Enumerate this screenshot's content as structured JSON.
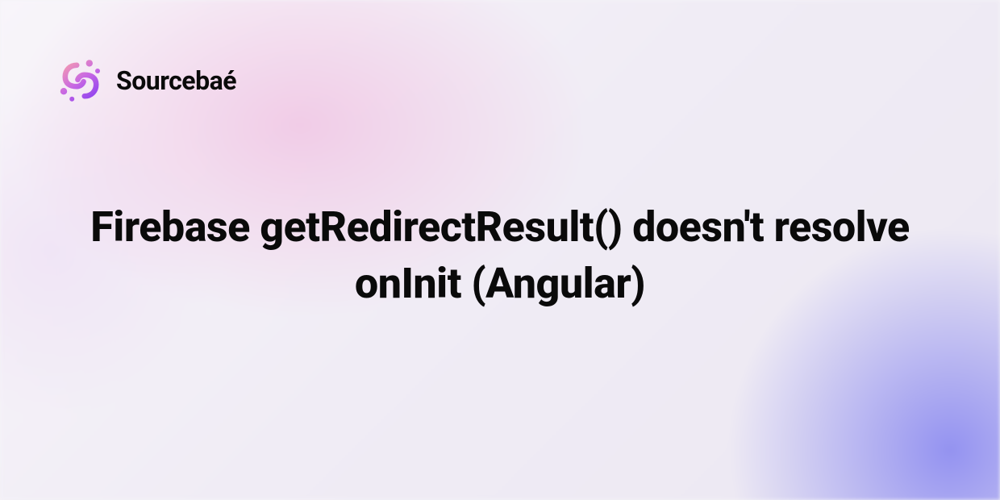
{
  "brand": {
    "name": "Sourcebaé",
    "icon_name": "sourcebae-logo-icon",
    "colors": {
      "gradient_start": "#f59bb0",
      "gradient_mid": "#c767e3",
      "gradient_end": "#8b3ff0"
    }
  },
  "headline": "Firebase getRedirectResult() doesn't resolve onInit (Angular)",
  "background": {
    "blob_pink": "#f0b4dc",
    "blob_purple": "#6e6ef0",
    "base": "#f5f3f7"
  }
}
